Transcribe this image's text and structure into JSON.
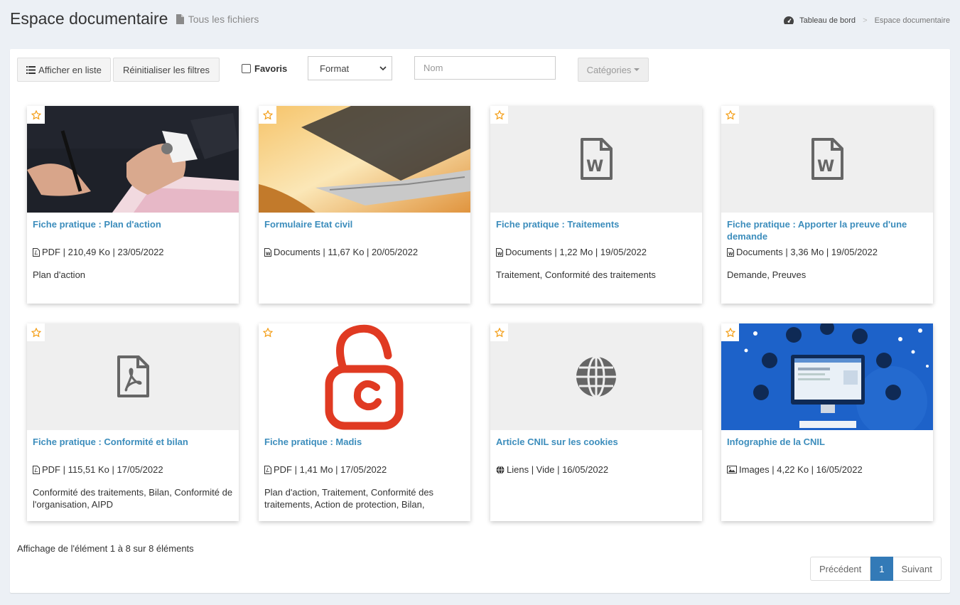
{
  "header": {
    "title": "Espace documentaire",
    "subtitle": "Tous les fichiers",
    "subtitle_icon": "file-icon"
  },
  "breadcrumb": {
    "icon": "dashboard-icon",
    "home": "Tableau de bord",
    "separator": ">",
    "current": "Espace documentaire"
  },
  "toolbar": {
    "list_view_label": "Afficher en liste",
    "reset_filters_label": "Réinitialiser les filtres",
    "favorites_label": "Favoris",
    "favorites_checked": false,
    "format_selected": "Format",
    "name_placeholder": "Nom",
    "categories_label": "Catégories"
  },
  "cards": [
    {
      "title": "Fiche pratique : Plan d'action",
      "meta": "PDF | 210,49 Ko | 23/05/2022",
      "tags": "Plan d'action",
      "file_icon": "pdf-file-icon",
      "thumb": "photo-signing-document"
    },
    {
      "title": "Formulaire Etat civil",
      "meta": "Documents | 11,67 Ko | 20/05/2022",
      "tags": "",
      "file_icon": "word-file-icon",
      "thumb": "photo-laptop"
    },
    {
      "title": "Fiche pratique : Traitements",
      "meta": "Documents | 1,22 Mo | 19/05/2022",
      "tags": "Traitement, Conformité des traitements",
      "file_icon": "word-file-icon",
      "thumb": "word-document-icon"
    },
    {
      "title": "Fiche pratique : Apporter la preuve d'une demande",
      "meta": "Documents | 3,36 Mo | 19/05/2022",
      "tags": "Demande, Preuves",
      "file_icon": "word-file-icon",
      "thumb": "word-document-icon"
    },
    {
      "title": "Fiche pratique : Conformité et bilan",
      "meta": "PDF | 115,51 Ko | 17/05/2022",
      "tags": "Conformité des traitements, Bilan, Conformité de l'organisation, AIPD",
      "file_icon": "pdf-file-icon",
      "thumb": "pdf-document-icon"
    },
    {
      "title": "Fiche pratique : Madis",
      "meta": "PDF | 1,41 Mo | 17/05/2022",
      "tags": "Plan d'action, Traitement, Conformité des traitements, Action de protection, Bilan,",
      "file_icon": "pdf-file-icon",
      "thumb": "madis-padlock-logo"
    },
    {
      "title": "Article CNIL sur les cookies",
      "meta": "Liens | Vide | 16/05/2022",
      "tags": "",
      "file_icon": "globe-icon",
      "thumb": "globe-icon"
    },
    {
      "title": "Infographie de la CNIL",
      "meta": "Images | 4,22 Ko | 16/05/2022",
      "tags": "",
      "file_icon": "image-file-icon",
      "thumb": "infographic-computer"
    }
  ],
  "footer": {
    "info": "Affichage de l'élément 1 à 8 sur 8 éléments",
    "prev_label": "Précédent",
    "current_page": "1",
    "next_label": "Suivant"
  },
  "colors": {
    "link": "#3c8dbc",
    "star": "#f39c12",
    "page_active": "#337ab7",
    "background": "#ecf0f5"
  }
}
